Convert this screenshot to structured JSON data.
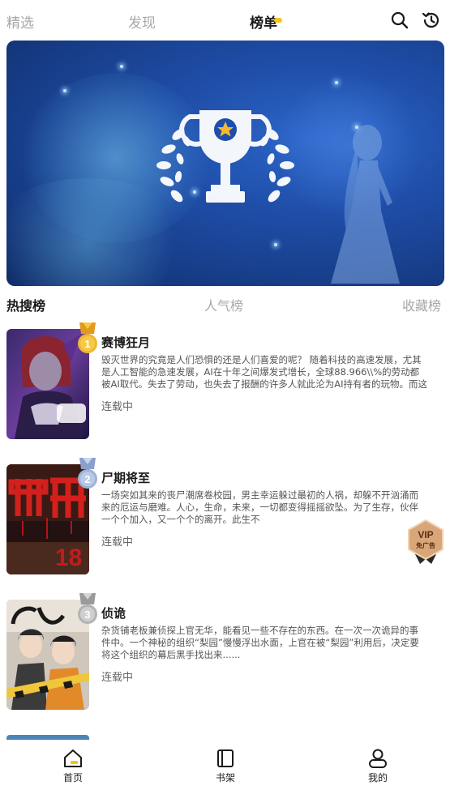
{
  "topnav": {
    "tabs": [
      "精选",
      "发现",
      "榜单"
    ],
    "active_tab": "榜单",
    "icons": [
      "search-icon",
      "history-icon"
    ]
  },
  "banner": {
    "icons": [
      "trophy-icon"
    ]
  },
  "rank_tabs": [
    "热搜榜",
    "人气榜",
    "收藏榜"
  ],
  "list": [
    {
      "rank": "1",
      "title": "赛博狂月",
      "desc": "毁灭世界的究竟是人们恐惧的还是人们喜爱的呢？ 随着科技的高速发展，尤其是人工智能的急速发展，AI在十年之间爆发式增长，全球88.966\\\\%的劳动都被AI取代。失去了劳动，也失去了报酬的许多人就此沦为AI持有者的玩物。而这个...",
      "status": "连载中"
    },
    {
      "rank": "2",
      "title": "尸期将至",
      "desc": "一场突如其来的丧尸潮席卷校园，男主幸运躲过最初的人祸，却躲不开汹涌而来的厄运与磨难。人心，生命，未来，一切都变得摇摇欲坠。为了生存，伙伴一个个加入，又一个个的离开。此生不",
      "status": "连载中"
    },
    {
      "rank": "3",
      "title": "侦诡",
      "desc": "杂货铺老板兼侦探上官无华，能看见一些不存在的东西。在一次一次诡异的事件中。一个神秘的组织“梨园”慢慢浮出水面，上官在被“梨园”利用后，决定要将这个组织的幕后黑手找出来......",
      "status": "连载中"
    }
  ],
  "vip_badge": {
    "line1": "VIP",
    "line2": "免广告"
  },
  "bottombar": {
    "items": [
      "首页",
      "书架",
      "我的"
    ],
    "icons": [
      "home-icon",
      "bookshelf-icon",
      "profile-icon"
    ]
  },
  "colors": {
    "accent": "#f5c518",
    "banner_blue": "#1f4ea9",
    "gold_medal": "#f0b732",
    "silver_medal": "#9eb3d9",
    "bronze_medal": "#b3b3b3"
  }
}
